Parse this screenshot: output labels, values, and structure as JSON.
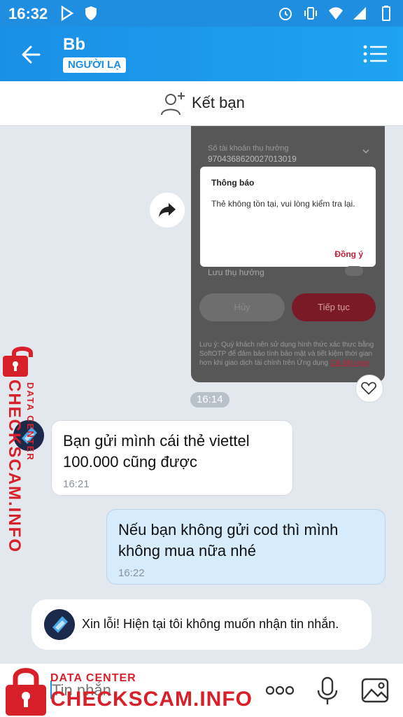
{
  "status_bar": {
    "time": "16:32"
  },
  "header": {
    "name": "Bb",
    "badge": "NGƯỜI LẠ"
  },
  "add_friend": {
    "label": "Kết bạn"
  },
  "shared_image": {
    "account_label": "Số tài khoản thụ hưởng",
    "account_number": "9704368620027013019",
    "dialog_title": "Thông báo",
    "dialog_message": "Thẻ không tồn tại, vui lòng kiểm tra lại.",
    "dialog_ok": "Đồng ý",
    "save_beneficiary": "Lưu thụ hưởng",
    "cancel": "Hủy",
    "continue": "Tiếp tục",
    "note": "Lưu ý: Quý khách nên sử dụng hình thức xác thực bằng SoftOTP để đảm bảo tính bảo mật và tiết kiệm thời gian hơn khi giao dịch tài chính trên Ứng dụng ",
    "note_link": "Cài đặt ngay",
    "time": "16:14"
  },
  "messages": [
    {
      "direction": "incoming",
      "line1": "Bạn gửi mình cái thẻ viettel",
      "line2": "100.000 cũng được",
      "time": "16:21"
    },
    {
      "direction": "outgoing",
      "line1": "Nếu bạn không gửi cod thì mình",
      "line2": "không mua nữa nhé",
      "time": "16:22"
    }
  ],
  "system_message": "Xin lỗi! Hiện tại tôi không muốn nhận tin nhắn.",
  "input": {
    "placeholder": "Tin nhắn"
  },
  "watermark": {
    "top": "DATA CENTER",
    "main": "CHECKSCAM.INFO"
  },
  "colors": {
    "header": "#1a8fe6",
    "outgoing_bubble": "#d6ebfc",
    "watermark": "#d8202a"
  }
}
